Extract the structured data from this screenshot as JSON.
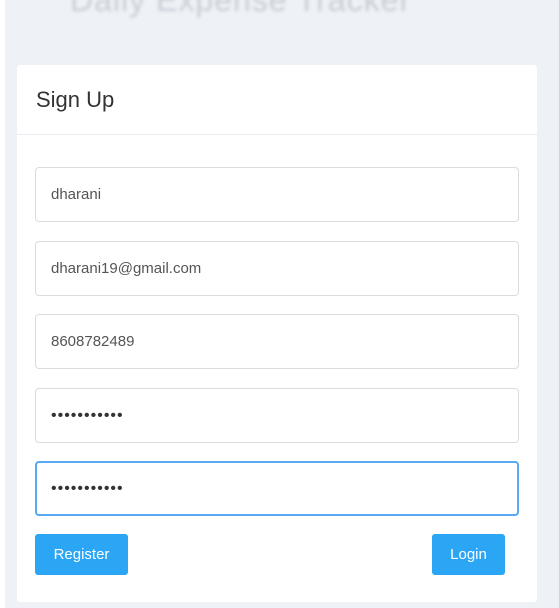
{
  "page": {
    "heading": "Daily Expense Tracker"
  },
  "card": {
    "title": "Sign Up"
  },
  "form": {
    "fields": [
      {
        "value": "dharani"
      },
      {
        "value": "dharani19@gmail.com"
      },
      {
        "value": "8608782489"
      },
      {
        "value": "•••••••••••"
      },
      {
        "value": "•••••••••••"
      }
    ],
    "register_label": "Register",
    "login_label": "Login"
  },
  "colors": {
    "accent": "#2ba6f5",
    "focus_border": "#56a9f2",
    "page_background": "#eef1f5"
  }
}
